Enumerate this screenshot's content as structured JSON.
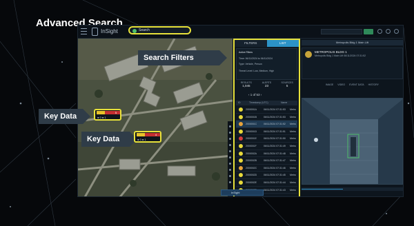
{
  "slide": {
    "title": "Advanced Search"
  },
  "app": {
    "brand": "InSight"
  },
  "search": {
    "value": "Search"
  },
  "topbar": {
    "go_label": "Go"
  },
  "callouts": {
    "search_filters": "Search Filters",
    "key_data_1": "Key Data",
    "key_data_2": "Key Data"
  },
  "tags": [
    {
      "cells": [
        "",
        "",
        "5"
      ],
      "colors": [
        "#e8c32a",
        "#c53030",
        "#c53030"
      ],
      "dots": "● 0   ● 1"
    },
    {
      "cells": [
        "",
        "",
        "4"
      ],
      "colors": [
        "#e8c32a",
        "#c53030",
        "#c53030"
      ],
      "dots": "● 0   ● 1"
    }
  ],
  "panel": {
    "tabs": [
      {
        "label": "FILTERS"
      },
      {
        "label": "LIST"
      }
    ],
    "filters_title": "Active Filters",
    "filter_lines": [
      "Time: 06/11/2024 to 06/11/2024",
      "Type: Vehicle, Person",
      "Threat Level: Low, Medium, High"
    ],
    "stats": [
      {
        "label": "RESULTS",
        "value": "1,045"
      },
      {
        "label": "ALERTS",
        "value": "23"
      },
      {
        "label": "SOURCES",
        "value": "5"
      }
    ],
    "pager": "1 of 53",
    "columns": [
      "ID",
      "Timestamp (UTC)",
      "Name"
    ],
    "rows": [
      {
        "id": "2000001A",
        "time": "06/11/2024 07:31:53",
        "name": "Metro",
        "color": "#e8d93a"
      },
      {
        "id": "2000001B",
        "time": "06/11/2024 07:31:53",
        "name": "Metro",
        "color": "#e8d93a"
      },
      {
        "id": "2000001C",
        "time": "06/11/2024 07:31:52",
        "name": "Metro",
        "color": "#e8a33a",
        "selected": true
      },
      {
        "id": "2000001D",
        "time": "06/11/2024 07:31:51",
        "name": "Metro",
        "color": "#e8d93a"
      },
      {
        "id": "2000001E",
        "time": "06/11/2024 07:31:50",
        "name": "Metro",
        "color": "#d23b3b"
      },
      {
        "id": "2000001F",
        "time": "06/11/2024 07:31:49",
        "name": "Metro",
        "color": "#e8d93a"
      },
      {
        "id": "2000002A",
        "time": "06/11/2024 07:31:48",
        "name": "Metro",
        "color": "#e8d93a"
      },
      {
        "id": "2000002B",
        "time": "06/11/2024 07:31:47",
        "name": "Metro",
        "color": "#e8d93a"
      },
      {
        "id": "2000002C",
        "time": "06/11/2024 07:31:46",
        "name": "Metro",
        "color": "#e8a33a"
      },
      {
        "id": "2000002D",
        "time": "06/11/2024 07:31:45",
        "name": "Metro",
        "color": "#e8d93a"
      },
      {
        "id": "2000002E",
        "time": "06/11/2024 07:31:44",
        "name": "Metro",
        "color": "#e8d93a"
      },
      {
        "id": "2000002F",
        "time": "06/11/2024 07:31:43",
        "name": "Metro",
        "color": "#e8d93a"
      }
    ]
  },
  "detail": {
    "header": "Metropolis Bldg 1 Main Lift",
    "name": "METROPOLIS BLDG 1",
    "sub": "Metropolis Bldg 1 Main Lift  06/11/2024 07:31:52",
    "tabs": [
      "IMAGE",
      "VIDEO",
      "EVENT DATA",
      "HISTORY"
    ]
  },
  "bottom": {
    "label": "InSight"
  },
  "colors": {
    "highlight": "#e8e23a",
    "accent": "#2c93c7"
  }
}
